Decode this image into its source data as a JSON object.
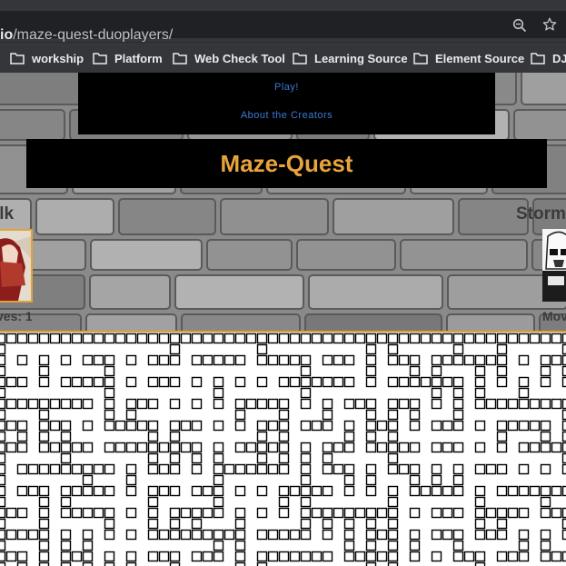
{
  "browser": {
    "url_host": "io",
    "url_path": "/maze-quest-duoplayers/",
    "bookmarks": [
      {
        "label": "workship"
      },
      {
        "label": "Platform"
      },
      {
        "label": "Web Check Tool"
      },
      {
        "label": "Learning Source"
      },
      {
        "label": "Element Source"
      },
      {
        "label": "DJ"
      }
    ]
  },
  "nav": {
    "play_label": "Play!",
    "about_label": "About the Creators"
  },
  "title": "Maze-Quest",
  "player1": {
    "name": "ilk",
    "moves_label": "ves: 1"
  },
  "player2": {
    "name": "Storm",
    "moves_label": "Mov"
  },
  "colors": {
    "title": "#e8a33c",
    "nav_link": "#3a7bd5",
    "accent_border": "#e0a23a"
  },
  "icons": [
    "folder-icon",
    "zoom-icon",
    "star-icon"
  ]
}
